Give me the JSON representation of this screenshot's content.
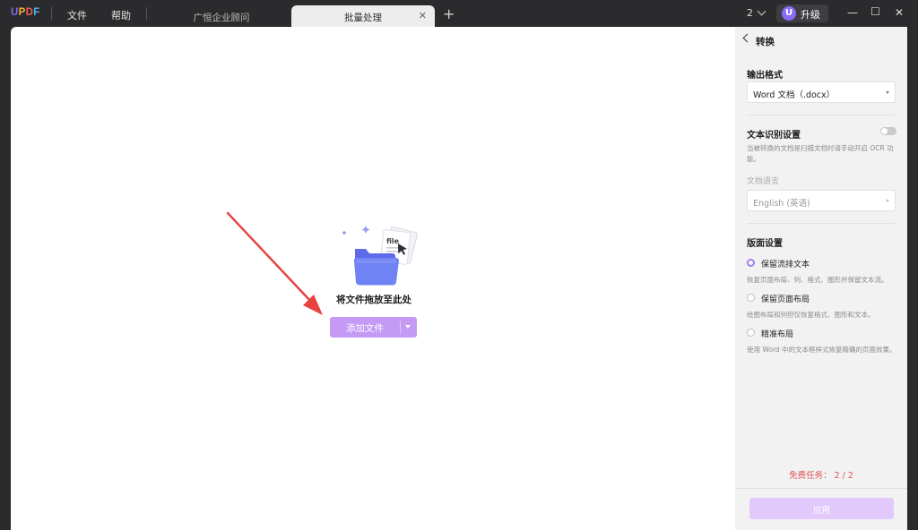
{
  "topbar": {
    "logo": "UPDF",
    "menu": [
      "文件",
      "帮助"
    ],
    "tabs": [
      {
        "label": "广恒企业顾问",
        "active": false
      },
      {
        "label": "批量处理",
        "active": true
      }
    ],
    "add_tab": "+",
    "window_count": "2",
    "upgrade_label": "升级",
    "upgrade_avatar": "U",
    "minimize": "—",
    "maximize": "☐",
    "close": "✕"
  },
  "main": {
    "drop_hint": "将文件拖放至此处",
    "add_file_label": "添加文件"
  },
  "panel": {
    "title": "转换",
    "output_format": {
      "heading": "输出格式",
      "value": "Word 文档（.docx）"
    },
    "ocr": {
      "heading": "文本识别设置",
      "description": "当被转换的文档是扫描文档时请手动开启 OCR 功能。",
      "enabled": false,
      "language_label": "文档语言",
      "language_value": "English (英语)"
    },
    "layout": {
      "heading": "版面设置",
      "options": [
        {
          "label": "保留流排文本",
          "description": "恢复页面布局、列、格式、图形并保留文本流。",
          "selected": true
        },
        {
          "label": "保留页面布局",
          "description": "绘图布局和列但仅恢复格式、图形和文本。",
          "selected": false
        },
        {
          "label": "精准布局",
          "description": "使用 Word 中的文本框样式恢复精确的页面效果。",
          "selected": false
        }
      ]
    },
    "free_tasks": "免费任务：  2 / 2",
    "apply_label": "应用"
  },
  "colors": {
    "accent": "#a57cf2",
    "button": "#c49af5",
    "apply_disabled": "#e2c9fb",
    "arrow": "#e8413e",
    "free_text": "#e05555"
  }
}
